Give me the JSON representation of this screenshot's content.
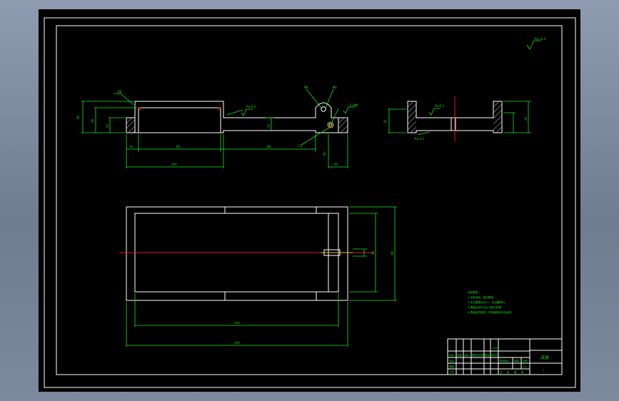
{
  "colors": {
    "background": "#000000",
    "outline": "#ffffff",
    "dimension": "#19e619",
    "centerline": "#e81818",
    "desktop": "#7d899d"
  },
  "drawing": {
    "roughness_symbol_text": "Ra 12.5",
    "front_view": {
      "dims": {
        "total_height": "50",
        "inner_height": "36",
        "slot_depth": "20",
        "left_offset": "10",
        "slot_width": "80",
        "arm_length": "88",
        "overall_length": "200",
        "right_width": "40",
        "boss_height": "15",
        "lug_height": "18"
      },
      "callouts": {
        "slot_label": "R8",
        "top_label": "R8",
        "hole_label": "Φ6",
        "hole_label_2": "2×Φ8",
        "chamfer_label": "C1",
        "roughness_1": "Ra 6.3",
        "roughness_2": "Ra 3.2"
      }
    },
    "side_view": {
      "dims": {
        "height": "30",
        "right_height": "20",
        "roughness": "Ra 6.3",
        "roughness_2": "Ra 3.2"
      }
    },
    "top_view": {
      "dims": {
        "inner_length": "334",
        "outer_length": "340",
        "inner_width": "40",
        "outer_width": "80"
      }
    },
    "notes": {
      "title": "技术要求：",
      "lines": [
        "1.去除毛刺，锐边倒钝。",
        "2.未注倒角均为C1，未注圆角R1。",
        "3.焊接后进行去应力退火处理。",
        "4.表面涂防锈漆，外表面喷涂灰色油漆。"
      ]
    },
    "title_block": {
      "part_name": "底座",
      "material": "Q235",
      "scale": "1:1",
      "sheet": "1",
      "row_labels": [
        "标记",
        "设计",
        "审核",
        "工艺"
      ],
      "col_labels": [
        "处数",
        "分区",
        "更改文件号",
        "签名",
        "年月日"
      ],
      "stage_labels": [
        "阶段标记",
        "重量",
        "比例"
      ],
      "footer": [
        "共",
        "张",
        "第",
        "张"
      ]
    }
  }
}
